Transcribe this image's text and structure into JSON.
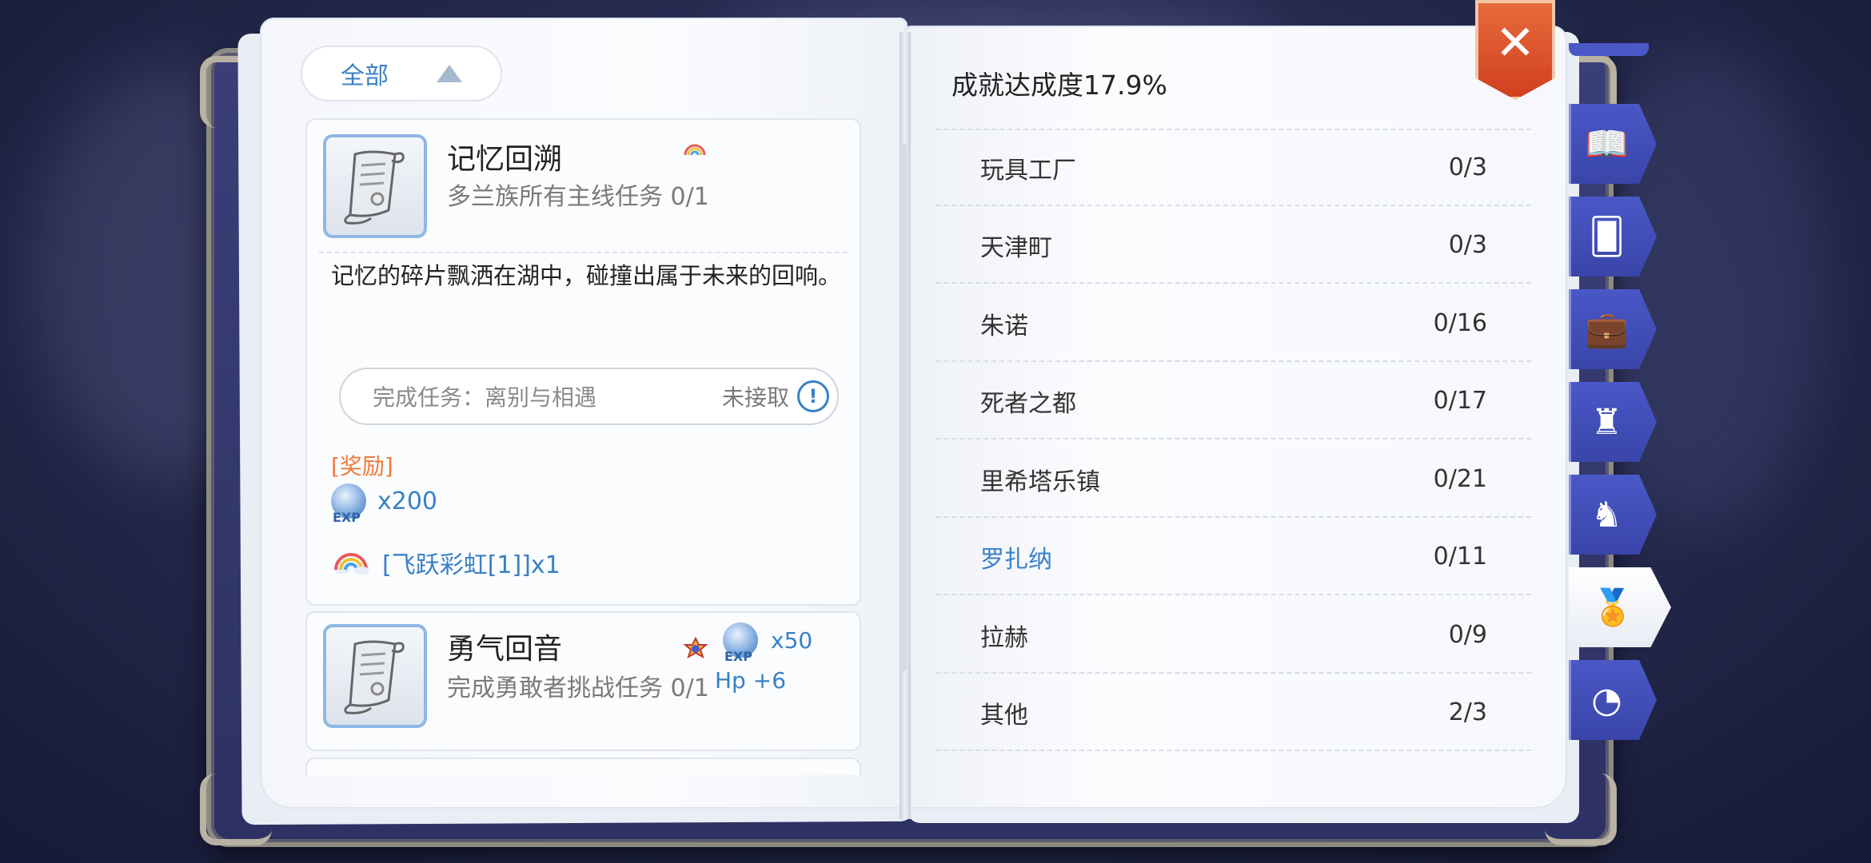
{
  "left_page": {
    "filter": {
      "label": "全部"
    },
    "quests": [
      {
        "name": "记忆回溯",
        "desc": "多兰族所有主线任务 0/1",
        "text": "记忆的碎片飘洒在湖中，碰撞出属于未来的回响。",
        "task": {
          "label": "完成任务：离别与相遇",
          "status": "未接取"
        },
        "reward_title": "[奖励]",
        "rewards": [
          {
            "icon": "exp-icon",
            "icon_text": "EXP",
            "text": "x200"
          },
          {
            "icon": "rainbow-icon",
            "text": "[飞跃彩虹[1]]x1"
          }
        ]
      },
      {
        "name": "勇气回音",
        "desc": "完成勇敢者挑战任务 0/1",
        "reward_exp_icon_text": "EXP",
        "reward_exp": "x50",
        "reward_hp": "Hp +6"
      }
    ]
  },
  "right_page": {
    "title": "成就达成度17.9%",
    "regions": [
      {
        "name": "玩具工厂",
        "count": "0/3"
      },
      {
        "name": "天津町",
        "count": "0/3"
      },
      {
        "name": "朱诺",
        "count": "0/16"
      },
      {
        "name": "死者之都",
        "count": "0/17"
      },
      {
        "name": "里希塔乐镇",
        "count": "0/21"
      },
      {
        "name": "罗扎纳",
        "count": "0/11",
        "active": true
      },
      {
        "name": "拉赫",
        "count": "0/9"
      },
      {
        "name": "其他",
        "count": "2/3"
      }
    ]
  },
  "close_label": "✕",
  "tabs": [
    {
      "icon": "book-icon",
      "glyph": "📖"
    },
    {
      "icon": "card-icon",
      "glyph": "🂠"
    },
    {
      "icon": "toolbox-icon",
      "glyph": "💼"
    },
    {
      "icon": "armchair-icon",
      "glyph": "♜"
    },
    {
      "icon": "rocking-horse-icon",
      "glyph": "♞"
    },
    {
      "icon": "medal-icon",
      "glyph": "🏅",
      "active": true
    },
    {
      "icon": "gauge-icon",
      "glyph": "◔"
    }
  ],
  "colors": {
    "accent": "#3a80c6",
    "reward": "#f07a3a",
    "tab": "#4a58c8",
    "close": "#d0401f"
  }
}
